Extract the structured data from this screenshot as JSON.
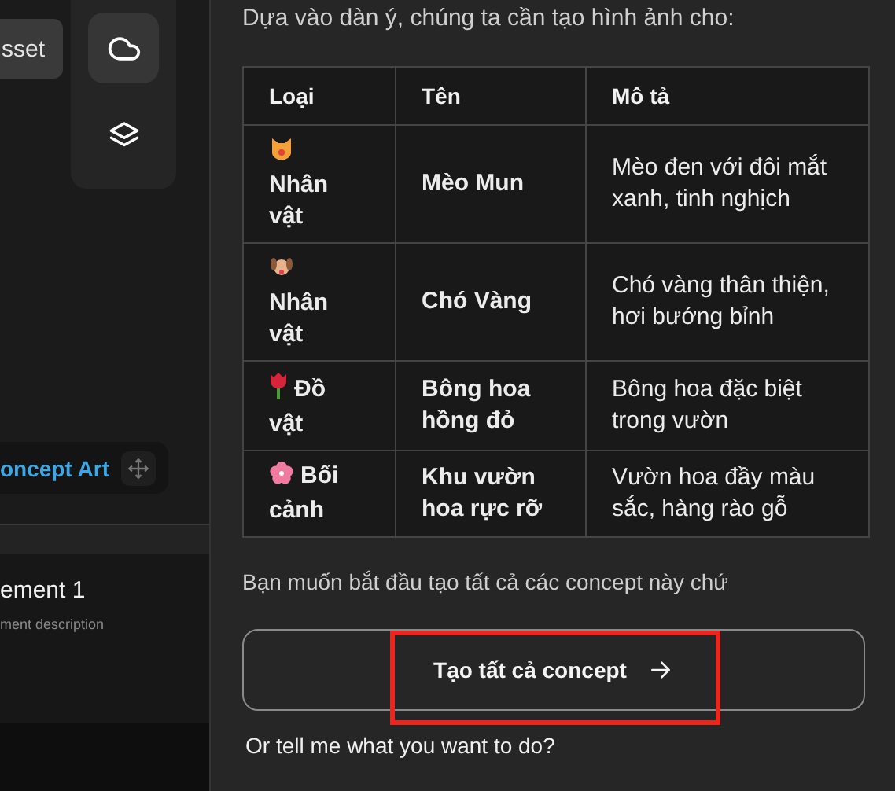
{
  "canvas": {
    "asset_button": "sset",
    "tools": [
      {
        "selected": true
      },
      {
        "selected": false
      }
    ],
    "node_label": "oncept Art"
  },
  "element_card": {
    "title": "ement 1",
    "description": "ment description"
  },
  "chat": {
    "intro": "Dựa vào dàn ý, chúng ta cần tạo hình ảnh cho:",
    "table": {
      "columns": [
        "Loại",
        "Tên",
        "Mô tả"
      ],
      "rows": [
        {
          "type": "Nhân vật",
          "name": "Mèo Mun",
          "description": "Mèo đen với đôi mắt xanh, tinh nghịch"
        },
        {
          "type": "Nhân vật",
          "name": "Chó Vàng",
          "description": "Chó vàng thân thiện, hơi bướng bỉnh"
        },
        {
          "type": "Đồ vật",
          "name": "Bông hoa hồng đỏ",
          "description": "Bông hoa đặc biệt trong vườn"
        },
        {
          "type": "Bối cảnh",
          "name": "Khu vườn hoa rực rỡ",
          "description": "Vườn hoa đầy màu sắc, hàng rào gỗ"
        }
      ]
    },
    "question": "Bạn muốn bắt đầu tạo tất cả các concept này chứ",
    "action_button": "Tạo tất cả concept",
    "highlighted": true,
    "prompt": "Or tell me what you want to do?"
  }
}
